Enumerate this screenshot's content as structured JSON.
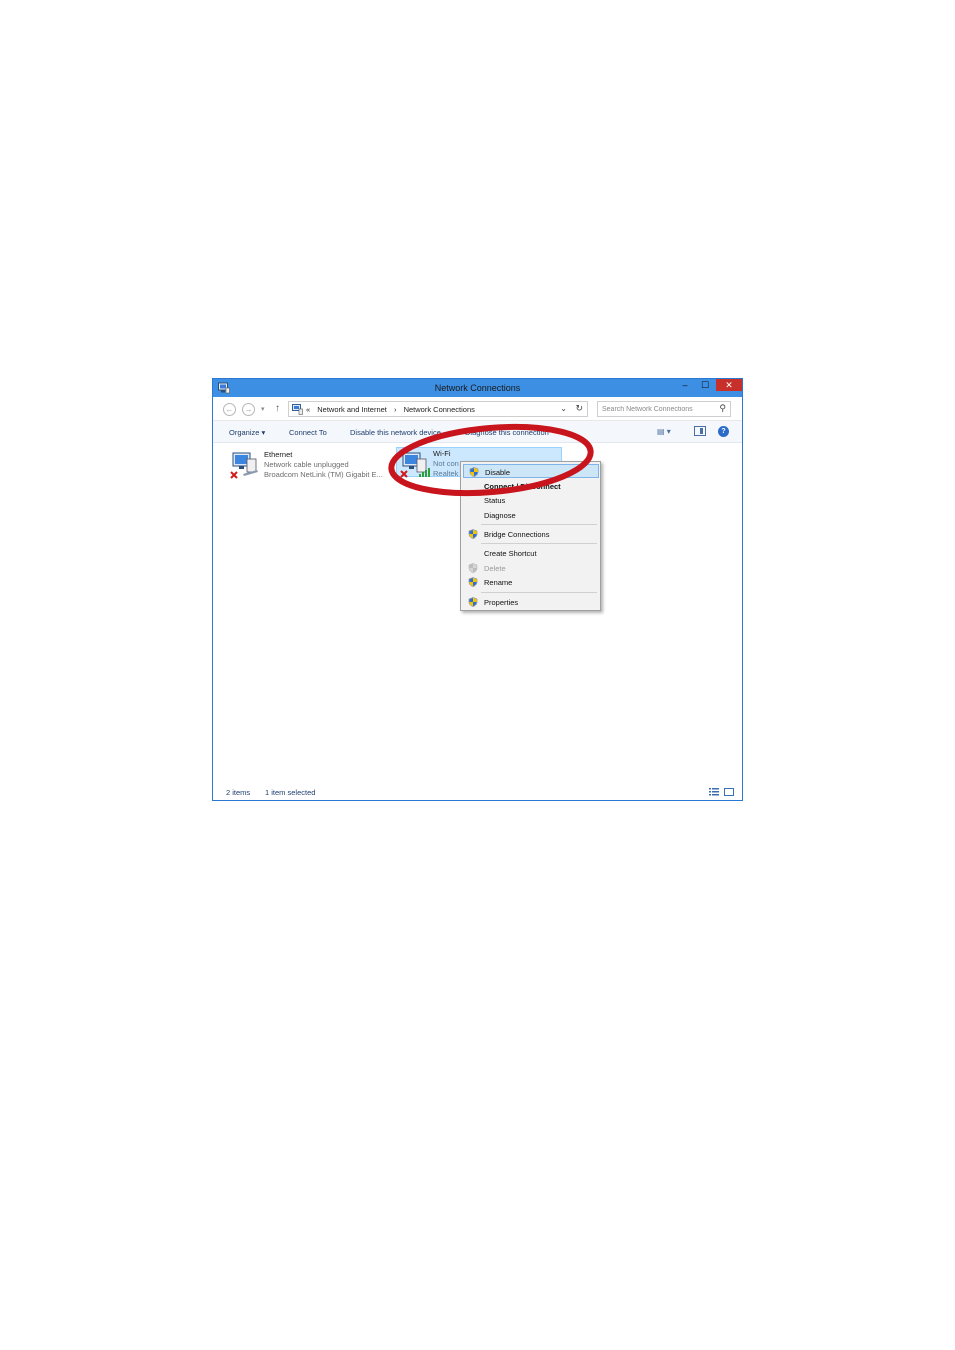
{
  "window": {
    "title": "Network Connections",
    "controls": {
      "minimize": "–",
      "maximize": "☐",
      "close": "✕"
    }
  },
  "navbar": {
    "back_glyph": "←",
    "forward_glyph": "→",
    "recent_glyph": "▾",
    "up_glyph": "↑",
    "address": {
      "prefix": "«",
      "crumbs": [
        "Network and Internet",
        "Network Connections"
      ],
      "separator": "›"
    },
    "address_chevron": "⌄",
    "refresh_glyph": "↻",
    "search_placeholder": "Search Network Connections",
    "search_glyph": "⚲"
  },
  "cmdbar": {
    "organize": "Organize ▾",
    "connect_to": "Connect To",
    "disable_device": "Disable this network device",
    "diagnose": "Diagnose this connection",
    "more": "»",
    "views_glyph": "▤ ▾",
    "help_glyph": "?"
  },
  "connections": [
    {
      "name": "Ethernet",
      "status": "Network cable unplugged",
      "device": "Broadcom NetLink (TM) Gigabit E..."
    },
    {
      "name": "Wi-Fi",
      "status": "Not con",
      "device": "Realtek"
    }
  ],
  "context_menu": [
    {
      "label": "Disable",
      "shield": true,
      "highlighted": true
    },
    {
      "label": "Connect / Disconnect",
      "bold": true
    },
    {
      "label": "Status"
    },
    {
      "label": "Diagnose"
    },
    {
      "label": "Bridge Connections",
      "shield": true
    },
    {
      "label": "Create Shortcut"
    },
    {
      "label": "Delete",
      "shield": true,
      "disabled": true
    },
    {
      "label": "Rename",
      "shield": true
    },
    {
      "label": "Properties",
      "shield": true
    }
  ],
  "statusbar": {
    "count": "2 items",
    "selected": "1 item selected"
  },
  "colors": {
    "titlebar": "#3c8fe3",
    "selection": "#cce8ff",
    "annotation": "#c8141c",
    "close": "#c7302a"
  },
  "icons": [
    "window-icon",
    "back-arrow-icon",
    "forward-arrow-icon",
    "up-arrow-icon",
    "control-panel-icon",
    "refresh-icon",
    "search-icon",
    "views-icon",
    "preview-pane-icon",
    "help-icon",
    "network-adapter-icon",
    "red-x-icon",
    "wifi-signal-icon",
    "uac-shield-icon",
    "details-view-icon",
    "large-icons-view-icon"
  ]
}
